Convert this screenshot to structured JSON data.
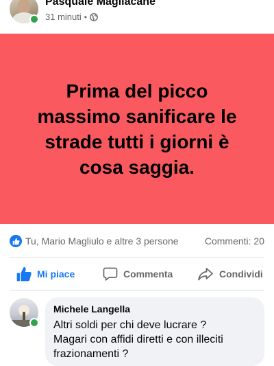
{
  "post": {
    "author": "Pasquale Magliacane",
    "time": "31 minuti",
    "separator": "•",
    "audience_icon": "globe-icon",
    "banner_lines": [
      "Prima del picco",
      "massimo sanificare le",
      "strade tutti i giorni è",
      "cosa saggia."
    ],
    "banner_color": "#fa5a5f"
  },
  "reactions": {
    "icon": "like-reaction-icon",
    "text": "Tu, Mario Magliulo e altre 3 persone",
    "comments": "Commenti: 20"
  },
  "actions": {
    "like": "Mi piace",
    "comment": "Commenta",
    "share": "Condividi"
  },
  "comment": {
    "author": "Michele Langella",
    "lines": [
      "Altri soldi per chi deve lucrare ?",
      "Magari con affidi diretti e con illeciti",
      "frazionamenti ?"
    ]
  },
  "colors": {
    "accent": "#1877f2",
    "online": "#31a24c"
  }
}
